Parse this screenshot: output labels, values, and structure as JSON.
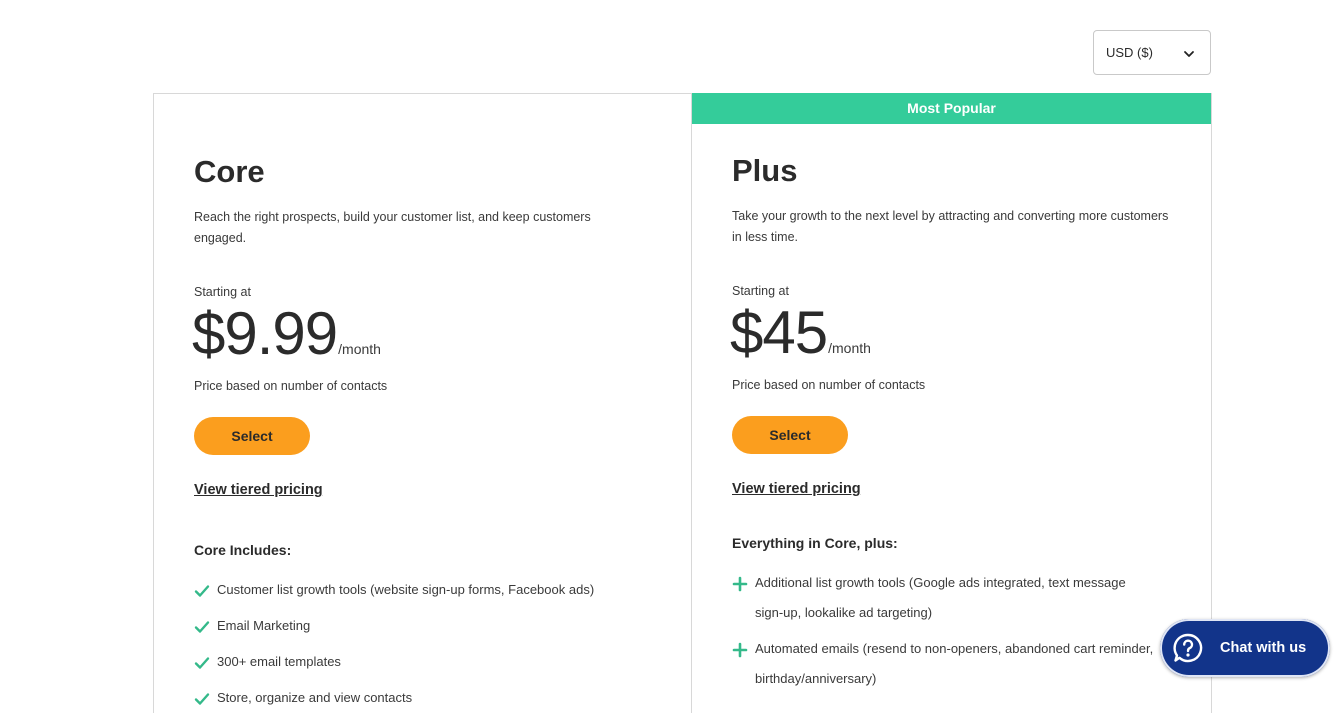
{
  "currency": {
    "selected": "USD ($)"
  },
  "plans": [
    {
      "name": "Core",
      "description": "Reach the right prospects, build your customer list, and keep customers engaged.",
      "starting_label": "Starting at",
      "price": "$9.99",
      "per": "/month",
      "basis": "Price based on number of contacts",
      "select_label": "Select",
      "tier_link": "View tiered pricing",
      "includes_title": "Core Includes:",
      "features": [
        "Customer list growth tools (website sign-up forms, Facebook ads)",
        "Email Marketing",
        "300+ email templates",
        "Store, organize and view contacts"
      ]
    },
    {
      "banner": "Most Popular",
      "name": "Plus",
      "description": "Take your growth to the next level by attracting and converting more customers in less time.",
      "starting_label": "Starting at",
      "price": "$45",
      "per": "/month",
      "basis": "Price based on number of contacts",
      "select_label": "Select",
      "tier_link": "View tiered pricing",
      "includes_title": "Everything in Core, plus:",
      "features": [
        "Additional list growth tools (Google ads integrated, text message sign-up, lookalike ad targeting)",
        "Automated emails (resend to non-openers, abandoned cart reminder, birthday/anniversary)"
      ]
    }
  ],
  "chat": {
    "label": "Chat with us"
  },
  "colors": {
    "accent_green": "#34cc9a",
    "button_orange": "#fb9e1e",
    "chat_navy": "#12348a"
  }
}
